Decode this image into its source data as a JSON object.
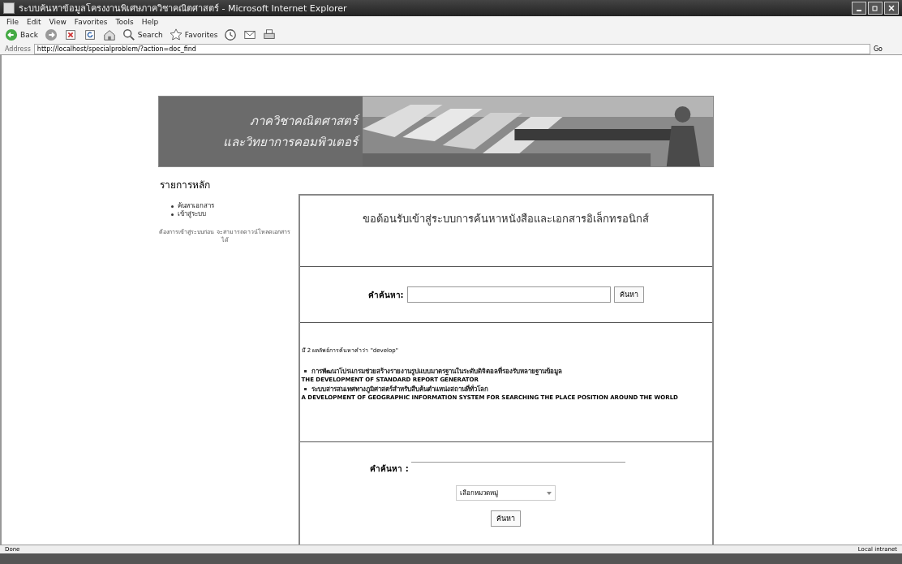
{
  "window": {
    "title": "ระบบค้นหาข้อมูลโครงงานพิเศษภาควิชาคณิตศาสตร์ - Microsoft Internet Explorer"
  },
  "menu": [
    "File",
    "Edit",
    "View",
    "Favorites",
    "Tools",
    "Help"
  ],
  "toolbar": [
    {
      "kind": "back",
      "label": "Back"
    },
    {
      "kind": "forward"
    },
    {
      "kind": "stop"
    },
    {
      "kind": "refresh"
    },
    {
      "kind": "home"
    },
    {
      "kind": "search",
      "label": "Search"
    },
    {
      "kind": "favorites",
      "label": "Favorites"
    },
    {
      "kind": "history"
    },
    {
      "kind": "mail"
    },
    {
      "kind": "print"
    }
  ],
  "address": {
    "label": "Address",
    "url": "http://localhost/specialproblem/?action=doc_find",
    "go": "Go"
  },
  "banner": {
    "lines": [
      "ภาควิชาคณิตศาสตร์",
      "และวิทยาการคอมพิวเตอร์"
    ]
  },
  "sidebar": {
    "heading": "รายการหลัก",
    "items": [
      "ค้นหาเอกสาร",
      "เข้าสู่ระบบ"
    ],
    "note": "ต้องการเข้าสู่ระบบก่อน จะสามารถดาวน์โหลดเอกสารได้"
  },
  "main": {
    "heading": "ขอต้อนรับเข้าสู่ระบบการค้นหาหนังสือและเอกสารอิเล็กทรอนิกส์",
    "search": {
      "label": "คำค้นหา:",
      "button": "ค้นหา"
    },
    "results": {
      "summary": "มี 2 ผลลัพธ์การค้นหาคำว่า \"develop\"",
      "items": [
        {
          "thai": "การพัฒนาโปรแกรมช่วยสร้างรายงานรูปแบบมาตรฐานในระดับดิจิตอลที่รองรับหลายฐานข้อมูล",
          "english": "THE DEVELOPMENT OF STANDARD REPORT GENERATOR"
        },
        {
          "thai": "ระบบสารสนเทศทางภูมิศาสตร์สำหรับสืบค้นตำแหน่งสถานที่ทั่วโลก",
          "english": "A DEVELOPMENT OF GEOGRAPHIC INFORMATION SYSTEM FOR SEARCHING THE PLACE POSITION AROUND THE WORLD"
        }
      ]
    },
    "advanced": {
      "label": "คำค้นหา :",
      "category": "เลือกหมวดหมู่",
      "button": "ค้นหา"
    }
  },
  "status_bar": {
    "text": "Done",
    "zone": "Local intranet"
  }
}
